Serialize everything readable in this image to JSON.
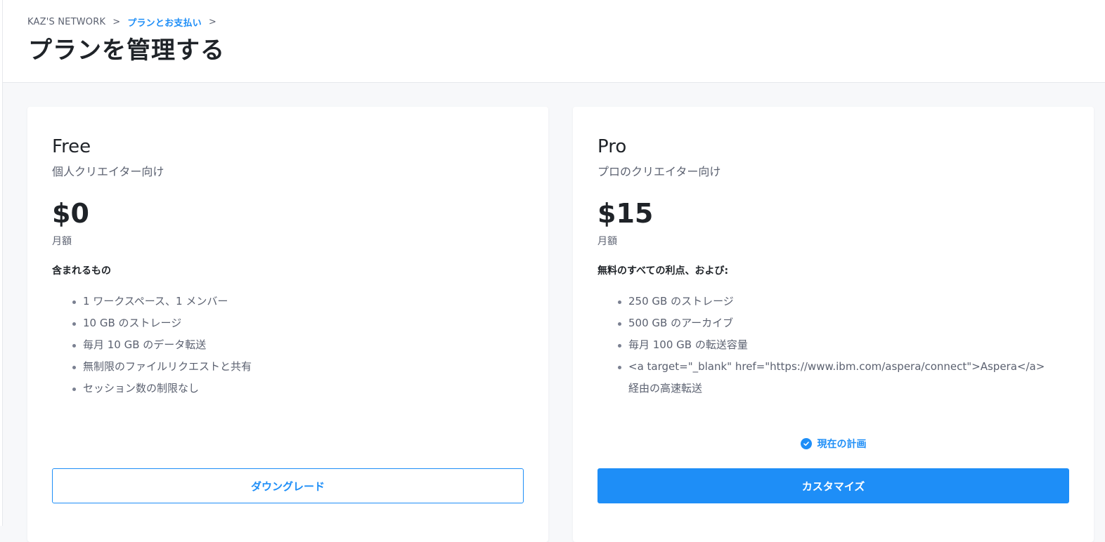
{
  "breadcrumb": {
    "root": "KAZ'S NETWORK",
    "separator": ">",
    "current": "プランとお支払い"
  },
  "page": {
    "title": "プランを管理する"
  },
  "plans": [
    {
      "name": "Free",
      "subtitle": "個人クリエイター向け",
      "price": "$0",
      "period": "月額",
      "includes_title": "含まれるもの",
      "features": [
        "1 ワークスペース、1 メンバー",
        "10 GB のストレージ",
        "毎月 10 GB のデータ転送",
        "無制限のファイルリクエストと共有",
        "セッション数の制限なし"
      ],
      "button_label": "ダウングレード"
    },
    {
      "name": "Pro",
      "subtitle": "プロのクリエイター向け",
      "price": "$15",
      "period": "月額",
      "includes_title": "無料のすべての利点、および:",
      "features": [
        "250 GB のストレージ",
        "500 GB のアーカイブ",
        "毎月 100 GB の転送容量",
        "<a target=\"_blank\" href=\"https://www.ibm.com/aspera/connect\">Aspera</a> 経由の高速転送"
      ],
      "current_plan_label": "現在の計画",
      "button_label": "カスタマイズ"
    }
  ],
  "colors": {
    "accent": "#1e8ef7",
    "text": "#1f2328",
    "muted": "#5b6170"
  },
  "icons": {
    "current_plan": "check-circle-icon"
  }
}
